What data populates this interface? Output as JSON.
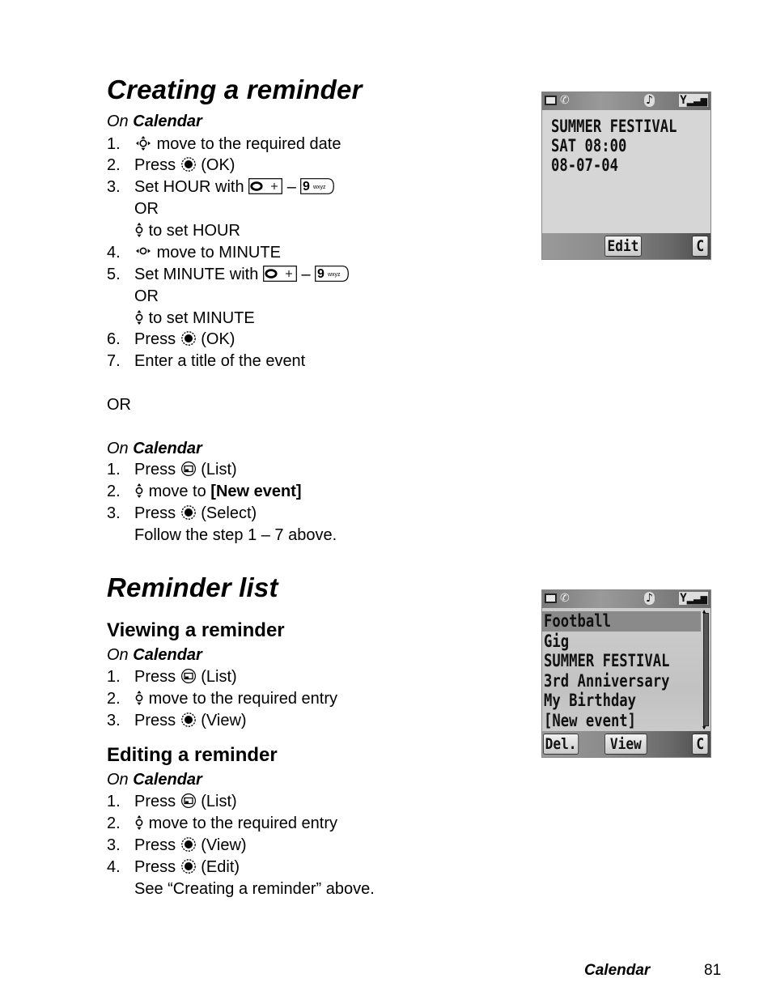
{
  "section1": {
    "title": "Creating a reminder",
    "context_on": "On",
    "context_app": "Calendar",
    "steps": [
      {
        "n": "1.",
        "icon": "nav-4way-icon",
        "text": "move to the required date"
      },
      {
        "n": "2.",
        "prefix": "Press",
        "icon": "center-select-icon",
        "text": "(OK)"
      },
      {
        "n": "3.",
        "prefix": "Set HOUR with",
        "key_from": "0 +",
        "dash": "–",
        "key_to": "9 wxyz"
      },
      {
        "sub": "OR"
      },
      {
        "sub_icon": "nav-updown-icon",
        "text": "to set HOUR"
      },
      {
        "n": "4.",
        "icon": "nav-leftright-icon",
        "text": "move to MINUTE"
      },
      {
        "n": "5.",
        "prefix": "Set MINUTE with",
        "key_from": "0 +",
        "dash": "–",
        "key_to": "9 wxyz"
      },
      {
        "sub": "OR"
      },
      {
        "sub_icon": "nav-updown-icon",
        "text": "to set MINUTE"
      },
      {
        "n": "6.",
        "prefix": "Press",
        "icon": "center-select-icon",
        "text": "(OK)"
      },
      {
        "n": "7.",
        "text": "Enter a title of the event"
      }
    ],
    "or_label": "OR",
    "alt_context_on": "On",
    "alt_context_app": "Calendar",
    "alt_steps": [
      {
        "n": "1.",
        "prefix": "Press",
        "icon": "list-key-icon",
        "text": "(List)"
      },
      {
        "n": "2.",
        "icon": "nav-updown-icon",
        "text": "move to",
        "bold": "[New event]"
      },
      {
        "n": "3.",
        "prefix": "Press",
        "icon": "center-select-icon",
        "text": "(Select)"
      },
      {
        "sub": "Follow the step 1 – 7 above."
      }
    ],
    "phone": {
      "lines": [
        "SUMMER FESTIVAL",
        "SAT 08:00",
        "08-07-04"
      ],
      "softkey_center": "Edit",
      "softkey_right": "C"
    }
  },
  "section2": {
    "title": "Reminder list",
    "viewing": {
      "title": "Viewing a reminder",
      "context_on": "On",
      "context_app": "Calendar",
      "steps": [
        {
          "n": "1.",
          "prefix": "Press",
          "icon": "list-key-icon",
          "text": "(List)"
        },
        {
          "n": "2.",
          "icon": "nav-updown-icon",
          "text": "move to the required entry"
        },
        {
          "n": "3.",
          "prefix": "Press",
          "icon": "center-select-icon",
          "text": "(View)"
        }
      ]
    },
    "editing": {
      "title": "Editing a reminder",
      "context_on": "On",
      "context_app": "Calendar",
      "steps": [
        {
          "n": "1.",
          "prefix": "Press",
          "icon": "list-key-icon",
          "text": "(List)"
        },
        {
          "n": "2.",
          "icon": "nav-updown-icon",
          "text": "move to the required entry"
        },
        {
          "n": "3.",
          "prefix": "Press",
          "icon": "center-select-icon",
          "text": "(View)"
        },
        {
          "n": "4.",
          "prefix": "Press",
          "icon": "center-select-icon",
          "text": "(Edit)"
        },
        {
          "sub": "See “Creating a reminder” above."
        }
      ]
    },
    "phone": {
      "items": [
        "Football",
        "Gig",
        "SUMMER FESTIVAL",
        "3rd Anniversary",
        "My Birthday",
        "[New event]"
      ],
      "selected_index": 0,
      "softkey_left": "Del.",
      "softkey_center": "View",
      "softkey_right": "C"
    }
  },
  "footer": {
    "section": "Calendar",
    "page": "81"
  }
}
